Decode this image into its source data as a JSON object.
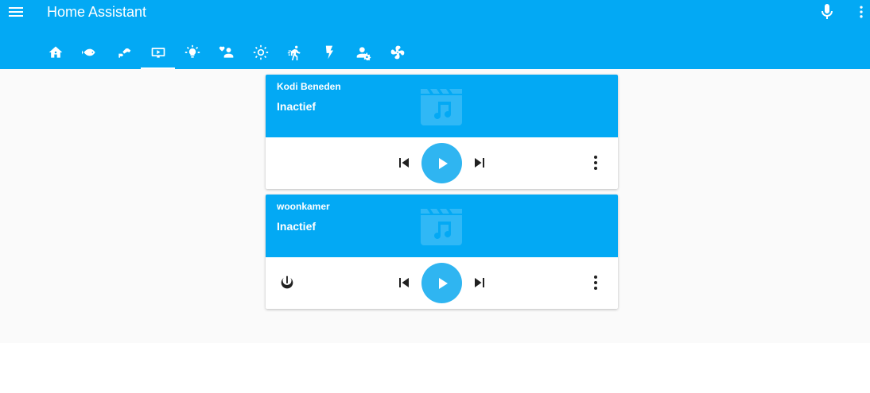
{
  "app": {
    "title": "Home Assistant"
  },
  "header": {
    "menu_icon": "menu-icon",
    "mic_icon": "microphone-icon",
    "more_icon": "dots-vertical-icon",
    "color": "#03a9f4"
  },
  "tabs": [
    {
      "icon": "home-icon",
      "active": false
    },
    {
      "icon": "fish-icon",
      "active": false
    },
    {
      "icon": "cctv-icon",
      "active": false
    },
    {
      "icon": "television-play-icon",
      "active": true
    },
    {
      "icon": "lightbulb-icon",
      "active": false
    },
    {
      "icon": "account-heart-icon",
      "active": false
    },
    {
      "icon": "brightness-icon",
      "active": false
    },
    {
      "icon": "run-icon",
      "active": false
    },
    {
      "icon": "flash-icon",
      "active": false
    },
    {
      "icon": "account-cog-icon",
      "active": false
    },
    {
      "icon": "fan-icon",
      "active": false
    }
  ],
  "players": [
    {
      "name": "Kodi Beneden",
      "state": "Inactief",
      "has_power": false
    },
    {
      "name": "woonkamer",
      "state": "Inactief",
      "has_power": true
    }
  ],
  "colors": {
    "accent": "#03a9f4",
    "play_button": "#2fb5f1",
    "background": "#fafafa"
  }
}
